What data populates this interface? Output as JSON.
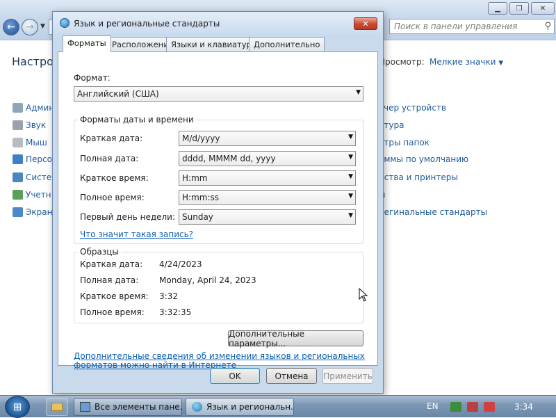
{
  "control_panel": {
    "search_placeholder": "Поиск в панели управления",
    "heading": "Настрой",
    "view_label": "Просмотр:",
    "view_value": "Мелкие значки",
    "left_items": [
      "Админ",
      "Звук",
      "Мыш",
      "Персон",
      "Систем",
      "Учетн",
      "Экран"
    ],
    "right_items": [
      "тчер устройств",
      "атура",
      "етры папок",
      "аммы по умолчанию",
      "йства и принтеры",
      "ы",
      "регинальные стандарты"
    ]
  },
  "dialog": {
    "title": "Язык и региональные стандарты",
    "close_glyph": "✕",
    "tabs": [
      "Форматы",
      "Расположение",
      "Языки и клавиатуры",
      "Дополнительно"
    ],
    "format_label": "Формат:",
    "format_value": "Английский (США)",
    "datetime_group_title": "Форматы даты и времени",
    "fields": [
      {
        "label": "Краткая дата:",
        "value": "M/d/yyyy"
      },
      {
        "label": "Полная дата:",
        "value": "dddd, MMMM dd, yyyy"
      },
      {
        "label": "Краткое время:",
        "value": "H:mm"
      },
      {
        "label": "Полное время:",
        "value": "H:mm:ss"
      },
      {
        "label": "Первый день недели:",
        "value": "Sunday"
      }
    ],
    "notation_link": "Что значит такая запись?",
    "samples_group_title": "Образцы",
    "samples": [
      {
        "label": "Краткая дата:",
        "value": "4/24/2023"
      },
      {
        "label": "Полная дата:",
        "value": "Monday, April 24, 2023"
      },
      {
        "label": "Краткое время:",
        "value": "3:32"
      },
      {
        "label": "Полное время:",
        "value": "3:32:35"
      }
    ],
    "additional_settings_button": "Дополнительные параметры...",
    "info_link_line1": "Дополнительные сведения об изменении языков и региональных",
    "info_link_line2": "форматов можно найти в Интернете",
    "ok_button": "OK",
    "cancel_button": "Отмена",
    "apply_button": "Применить"
  },
  "taskbar": {
    "tasks": [
      "Все элементы пане...",
      "Язык и региональн..."
    ],
    "language": "EN",
    "clock": "3:34"
  }
}
